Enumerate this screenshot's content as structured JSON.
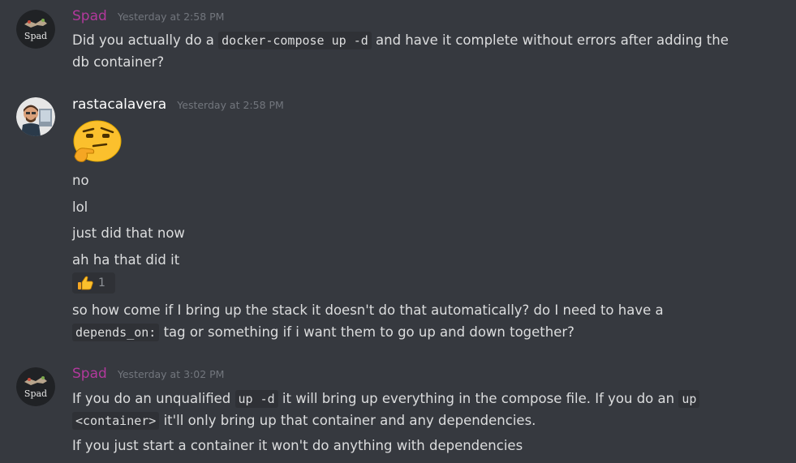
{
  "colors": {
    "background": "#36393f",
    "spad_name": "#b2399c",
    "rasta_name": "#ffffff",
    "timestamp": "#72767d",
    "text": "#dcddde",
    "code_bg": "#2f3136"
  },
  "messages": [
    {
      "author": "Spad",
      "timestamp": "Yesterday at 2:58 PM",
      "avatar_text": "Spad",
      "lines": [
        {
          "before": "Did you actually do a ",
          "code": "docker-compose up -d",
          "after": " and have it complete without errors after adding the"
        },
        {
          "text": "db container?"
        }
      ]
    },
    {
      "author": "rastacalavera",
      "timestamp": "Yesterday at 2:58 PM",
      "emoji": "thinking-face",
      "lines": [
        {
          "text": "no"
        },
        {
          "text": "lol"
        },
        {
          "text": "just did that now"
        },
        {
          "text": "ah ha that did it"
        },
        {
          "text": "so how come if I bring up the stack it doesn't do that automatically? do I need to have a"
        },
        {
          "code": "depends_on:",
          "after": " tag or something if i want them to go up and down together?"
        }
      ],
      "reaction": {
        "emoji": "thumbs-up",
        "count": "1"
      }
    },
    {
      "author": "Spad",
      "timestamp": "Yesterday at 3:02 PM",
      "avatar_text": "Spad",
      "lines": [
        {
          "before": "If you do an unqualified ",
          "code": "up -d",
          "after": " it will bring up everything in the compose file. If you do an ",
          "code2": "up"
        },
        {
          "code": "<container>",
          "after": " it'll only bring up that container and any dependencies."
        },
        {
          "text": "If you just start a container it won't do anything with dependencies"
        }
      ]
    }
  ]
}
